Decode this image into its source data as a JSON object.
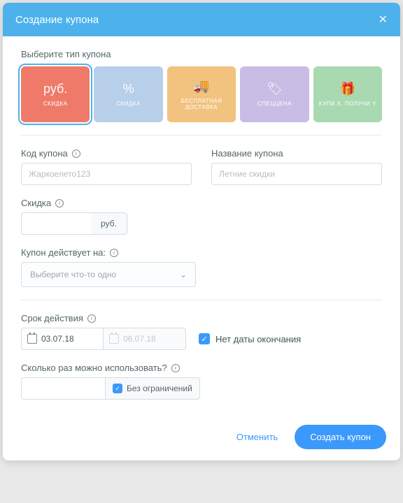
{
  "header": {
    "title": "Создание купона"
  },
  "typeSection": {
    "label": "Выберите тип купона",
    "types": [
      {
        "icon": "руб.",
        "label": "СКИДКА",
        "color": "#f07a6a",
        "selected": true
      },
      {
        "icon": "%",
        "label": "СКИДКА",
        "color": "#b7cfe8",
        "selected": false
      },
      {
        "icon": "🚚",
        "label": "БЕСПЛАТНАЯ ДОСТАВКА",
        "color": "#f2c27f",
        "selected": false
      },
      {
        "icon": "🏷",
        "label": "СПЕЦЦЕНА",
        "color": "#c9bde6",
        "selected": false
      },
      {
        "icon": "🎁",
        "label": "КУПИ X, ПОЛУЧИ Y",
        "color": "#a9d9b0",
        "selected": false
      }
    ]
  },
  "codeField": {
    "label": "Код купона",
    "placeholder": "Жаркоелето123"
  },
  "nameField": {
    "label": "Название купона",
    "placeholder": "Летние скидки"
  },
  "discountField": {
    "label": "Скидка",
    "suffix": "руб."
  },
  "appliesField": {
    "label": "Купон действует на:",
    "placeholder": "Выберите что-то одно"
  },
  "validityField": {
    "label": "Срок действия",
    "start": "03.07.18",
    "end": "06.07.18",
    "noEndLabel": "Нет даты окончания"
  },
  "usageField": {
    "label": "Сколько раз можно использовать?",
    "unlimitedLabel": "Без ограничений"
  },
  "footer": {
    "cancel": "Отменить",
    "submit": "Создать купон"
  }
}
